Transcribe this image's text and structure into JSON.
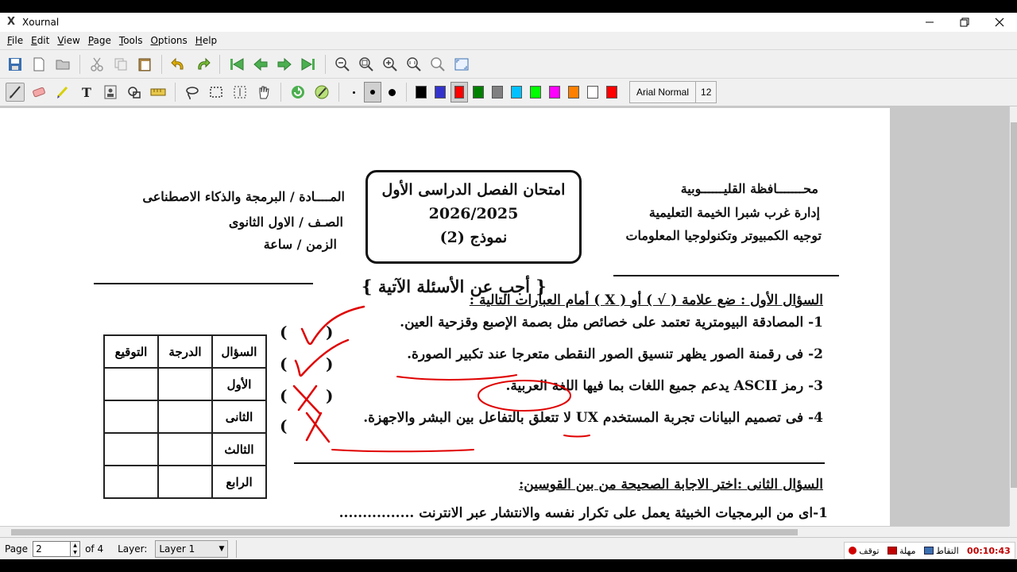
{
  "window": {
    "title": "Xournal",
    "app_icon": "X"
  },
  "menu": [
    "File",
    "Edit",
    "View",
    "Page",
    "Tools",
    "Options",
    "Help"
  ],
  "toolbar": {
    "font_name": "Arial Normal",
    "font_size": "12",
    "colors": [
      "#000000",
      "#3333cc",
      "#ff0000",
      "#008000",
      "#808080",
      "#00c0ff",
      "#00ff00",
      "#ff00ff",
      "#ff8000",
      "#ffffff",
      "#ff0000"
    ],
    "active_color_index": 2
  },
  "document": {
    "header_right": [
      "محـــــــافظة القليــــــوبية",
      "إدارة غرب شبرا الخيمة التعليمية",
      "توجيه الكمبيوتر وتكنولوجيا المعلومات"
    ],
    "header_center": [
      "امتحان الفصل الدراسى الأول",
      "2026/2025",
      "نموذج (2)"
    ],
    "header_left": [
      "المــــادة / البرمجة والذكاء الاصطناعى",
      "الصـف  / الاول الثانوى",
      "الزمن / ساعة"
    ],
    "instruction": "{ أجب عن الأسئلة الآتية }",
    "q1_title": "السؤال الأول : ضع علامة ( √ ) أو ( X ) أمام العبارات التالية :",
    "q1_items": [
      "1-    المصادقة البيومترية تعتمد على خصائص مثل بصمة الإصبع وقزحية العين.",
      "2- فى رقمنة الصور يظهر تنسيق الصور النقطى متعرجا عند تكبير الصورة.",
      "3- رمز  ASCII  يدعم جميع اللغات بما فيها اللغة العربية.",
      "4-  فى تصميم البيانات تجربة المستخدم UX لا تتعلق بالتفاعل بين البشر والاجهزة."
    ],
    "paren_open": "(",
    "paren_close": ")",
    "q2_title": "السؤال الثانى :اختر الاجابة الصحيحة من بين القوسين:",
    "q2_items": [
      "1-اى من البرمجيات الخبيثة يعمل على تكرار نفسه والانتشار عبر الانترنت ................"
    ],
    "score_table": {
      "headers": [
        "السؤال",
        "الدرجة",
        "التوقيع"
      ],
      "rows": [
        "الأول",
        "الثانى",
        "الثالث",
        "الرابع"
      ]
    }
  },
  "status": {
    "page_label": "Page",
    "page_value": "2",
    "page_of": "of 4",
    "layer_label": "Layer:",
    "layer_value": "Layer 1"
  },
  "recorder": {
    "time": "00:10:43",
    "capture": "التقاط",
    "pause": "مهلة",
    "stop": "توقف"
  }
}
